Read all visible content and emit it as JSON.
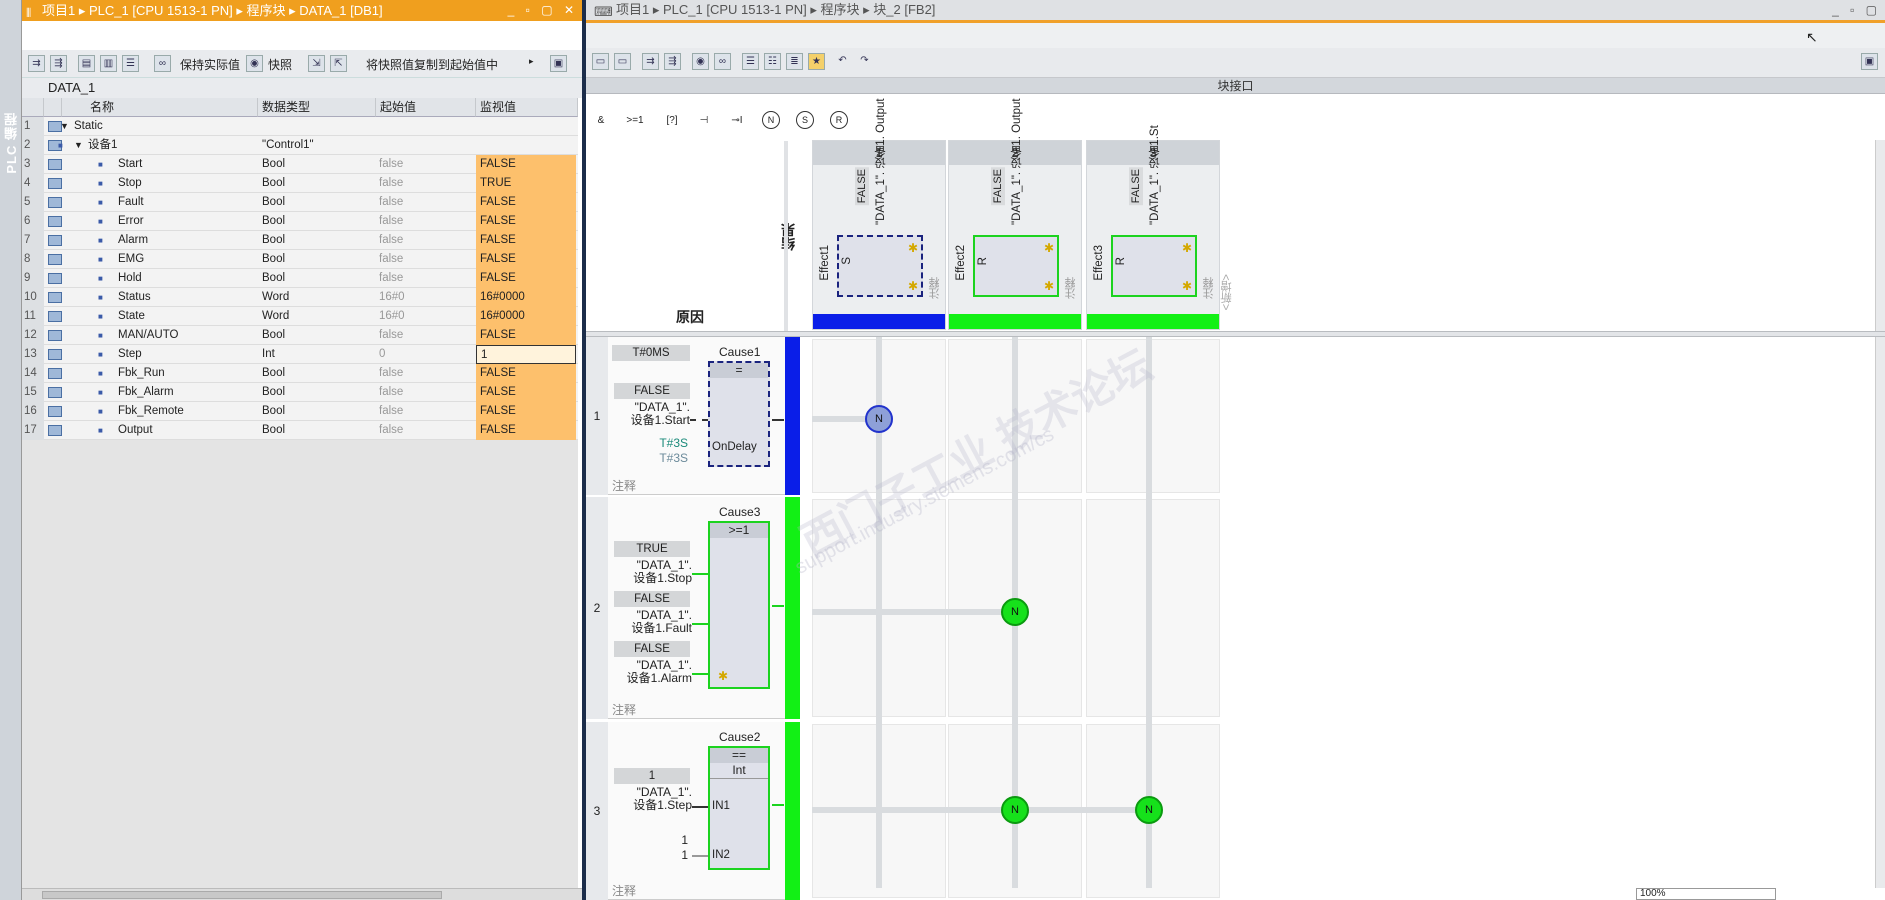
{
  "sidebar": {
    "label": "PLC 编程"
  },
  "left_window": {
    "title": "项目1 ▸ PLC_1 [CPU 1513-1 PN] ▸ 程序块 ▸ DATA_1 [DB1]",
    "window_controls": "_ ▫ ▢ ✕",
    "toolbar": {
      "keep_actual": "保持实际值",
      "snapshot": "快照",
      "copy_snapshot": "将快照值复制到起始值中"
    },
    "db_name": "DATA_1",
    "columns": [
      "名称",
      "数据类型",
      "起始值",
      "监视值"
    ],
    "rows": [
      {
        "no": "1",
        "name": "Static",
        "type": "",
        "start": "",
        "monitor": "",
        "lvl": 0,
        "expand": true
      },
      {
        "no": "2",
        "name": "设备1",
        "type": "\"Control1\"",
        "start": "",
        "monitor": "",
        "lvl": 1,
        "expand": true
      },
      {
        "no": "3",
        "name": "Start",
        "type": "Bool",
        "start": "false",
        "monitor": "FALSE",
        "lvl": 2
      },
      {
        "no": "4",
        "name": "Stop",
        "type": "Bool",
        "start": "false",
        "monitor": "TRUE",
        "lvl": 2
      },
      {
        "no": "5",
        "name": "Fault",
        "type": "Bool",
        "start": "false",
        "monitor": "FALSE",
        "lvl": 2
      },
      {
        "no": "6",
        "name": "Error",
        "type": "Bool",
        "start": "false",
        "monitor": "FALSE",
        "lvl": 2
      },
      {
        "no": "7",
        "name": "Alarm",
        "type": "Bool",
        "start": "false",
        "monitor": "FALSE",
        "lvl": 2
      },
      {
        "no": "8",
        "name": "EMG",
        "type": "Bool",
        "start": "false",
        "monitor": "FALSE",
        "lvl": 2
      },
      {
        "no": "9",
        "name": "Hold",
        "type": "Bool",
        "start": "false",
        "monitor": "FALSE",
        "lvl": 2
      },
      {
        "no": "10",
        "name": "Status",
        "type": "Word",
        "start": "16#0",
        "monitor": "16#0000",
        "lvl": 2
      },
      {
        "no": "11",
        "name": "State",
        "type": "Word",
        "start": "16#0",
        "monitor": "16#0000",
        "lvl": 2
      },
      {
        "no": "12",
        "name": "MAN/AUTO",
        "type": "Bool",
        "start": "false",
        "monitor": "FALSE",
        "lvl": 2
      },
      {
        "no": "13",
        "name": "Step",
        "type": "Int",
        "start": "0",
        "monitor": "1",
        "lvl": 2,
        "edit": true
      },
      {
        "no": "14",
        "name": "Fbk_Run",
        "type": "Bool",
        "start": "false",
        "monitor": "FALSE",
        "lvl": 2
      },
      {
        "no": "15",
        "name": "Fbk_Alarm",
        "type": "Bool",
        "start": "false",
        "monitor": "FALSE",
        "lvl": 2
      },
      {
        "no": "16",
        "name": "Fbk_Remote",
        "type": "Bool",
        "start": "false",
        "monitor": "FALSE",
        "lvl": 2
      },
      {
        "no": "17",
        "name": "Output",
        "type": "Bool",
        "start": "false",
        "monitor": "FALSE",
        "lvl": 2
      }
    ]
  },
  "right_window": {
    "title": "项目1 ▸ PLC_1 [CPU 1513-1 PN] ▸ 程序块 ▸ 块_2 [FB2]",
    "window_controls": "_ ▫ ▢",
    "interface_bar": "块接口",
    "operators": [
      "&",
      ">=1",
      "[?]",
      "⊣",
      "⊸I",
      "N",
      "S",
      "R"
    ],
    "result_label": "结果",
    "cause_label": "原因",
    "add_new": "<新增>",
    "comment_label": "注释",
    "effects": [
      {
        "num": "1",
        "value": "FALSE",
        "tag": "\"DATA_1\". 设备1. Output",
        "name": "Effect1",
        "action": "S",
        "bar": "#0a1ee8",
        "dashed": true
      },
      {
        "num": "2",
        "value": "FALSE",
        "tag": "\"DATA_1\". 设备1. Output",
        "name": "Effect2",
        "action": "R",
        "bar": "#12f015",
        "dashed": false
      },
      {
        "num": "3",
        "value": "FALSE",
        "tag": "\"DATA_1\". 设备1.St",
        "name": "Effect3",
        "action": "R",
        "bar": "#12f015",
        "dashed": false
      }
    ],
    "causes": [
      {
        "row": "1",
        "name": "Cause1",
        "func": "=",
        "extra": "OnDelay",
        "time_label": "T#0MS",
        "inputs": [
          {
            "value": "FALSE",
            "tag1": "\"DATA_1\".",
            "tag2": "设备1.Start"
          }
        ],
        "t1": "T#3S",
        "t2": "T#3S",
        "bar": "#0a1ee8"
      },
      {
        "row": "2",
        "name": "Cause3",
        "func": ">=1",
        "inputs": [
          {
            "value": "TRUE",
            "tag1": "\"DATA_1\".",
            "tag2": "设备1.Stop"
          },
          {
            "value": "FALSE",
            "tag1": "\"DATA_1\".",
            "tag2": "设备1.Fault"
          },
          {
            "value": "FALSE",
            "tag1": "\"DATA_1\".",
            "tag2": "设备1.Alarm"
          }
        ],
        "bar": "#12f015"
      },
      {
        "row": "3",
        "name": "Cause2",
        "func": "==",
        "func2": "Int",
        "inputs": [
          {
            "value": "1",
            "tag1": "\"DATA_1\".",
            "tag2": "设备1.Step"
          }
        ],
        "in1": "IN1",
        "in2": "IN2",
        "in2a": "1",
        "in2b": "1",
        "bar": "#12f015"
      }
    ],
    "node_label": "N",
    "zoom": "100%"
  }
}
